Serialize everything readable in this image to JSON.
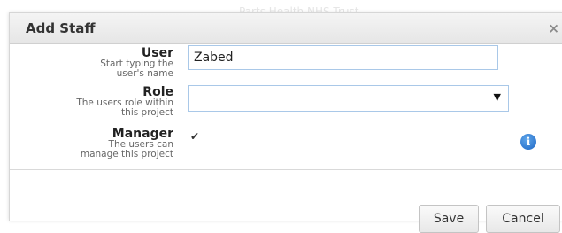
{
  "backdrop": {
    "faint_text": "Parts Health NHS Trust"
  },
  "dialog": {
    "title": "Add Staff",
    "close_glyph": "×"
  },
  "form": {
    "user": {
      "label": "User",
      "help_line1": "Start typing the",
      "help_line2": "user's name",
      "value": "Zabed"
    },
    "role": {
      "label": "Role",
      "help_line1": "The users role within",
      "help_line2": "this project",
      "selected_value": "",
      "arrow_glyph": "▼"
    },
    "manager": {
      "label": "Manager",
      "help_line1": "The users can",
      "help_line2": "manage this project",
      "checked": true,
      "check_glyph": "✔"
    },
    "info_icon": "info-icon",
    "info_glyph": "i"
  },
  "buttons": {
    "save_label": "Save",
    "cancel_label": "Cancel"
  },
  "colors": {
    "input_border": "#a9c8e8",
    "info_blue": "#1d66c4",
    "title_bar": "#e6e6e6"
  }
}
